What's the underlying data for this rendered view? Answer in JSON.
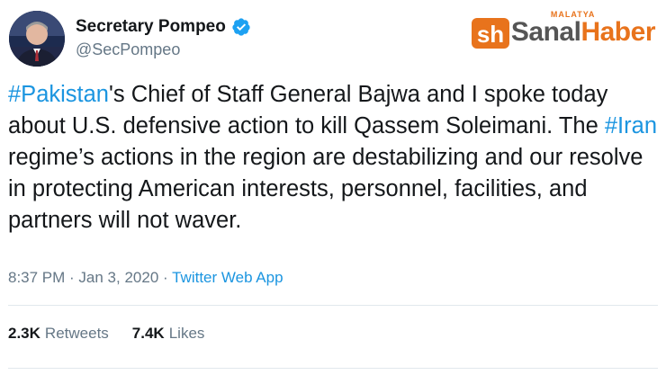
{
  "author": {
    "display_name": "Secretary Pompeo",
    "handle": "@SecPompeo"
  },
  "watermark": {
    "small": "MALATYA",
    "part1": "Sanal",
    "part2": "Haber"
  },
  "tweet": {
    "hashtag_1": "#Pakistan",
    "text_1": "'s Chief of Staff General Bajwa and I spoke today about U.S. defensive action to kill Qassem Soleimani. The ",
    "hashtag_2": "#Iran",
    "text_2": " regime’s actions in the region are destabilizing and our resolve in protecting American interests, personnel, facilities, and partners will not waver."
  },
  "meta": {
    "time": "8:37 PM",
    "separator_1": " · ",
    "date": "Jan 3, 2020",
    "separator_2": " · ",
    "source": "Twitter Web App"
  },
  "stats": {
    "retweets_count": "2.3K",
    "retweets_label": "Retweets",
    "likes_count": "7.4K",
    "likes_label": "Likes"
  },
  "colors": {
    "link_blue": "#1b95e0",
    "verified_blue": "#1da1f2",
    "secondary_gray": "#657786",
    "watermark_orange": "#e8731c"
  },
  "icons": {
    "verified": "verified-badge-icon",
    "avatar": "user-avatar"
  }
}
